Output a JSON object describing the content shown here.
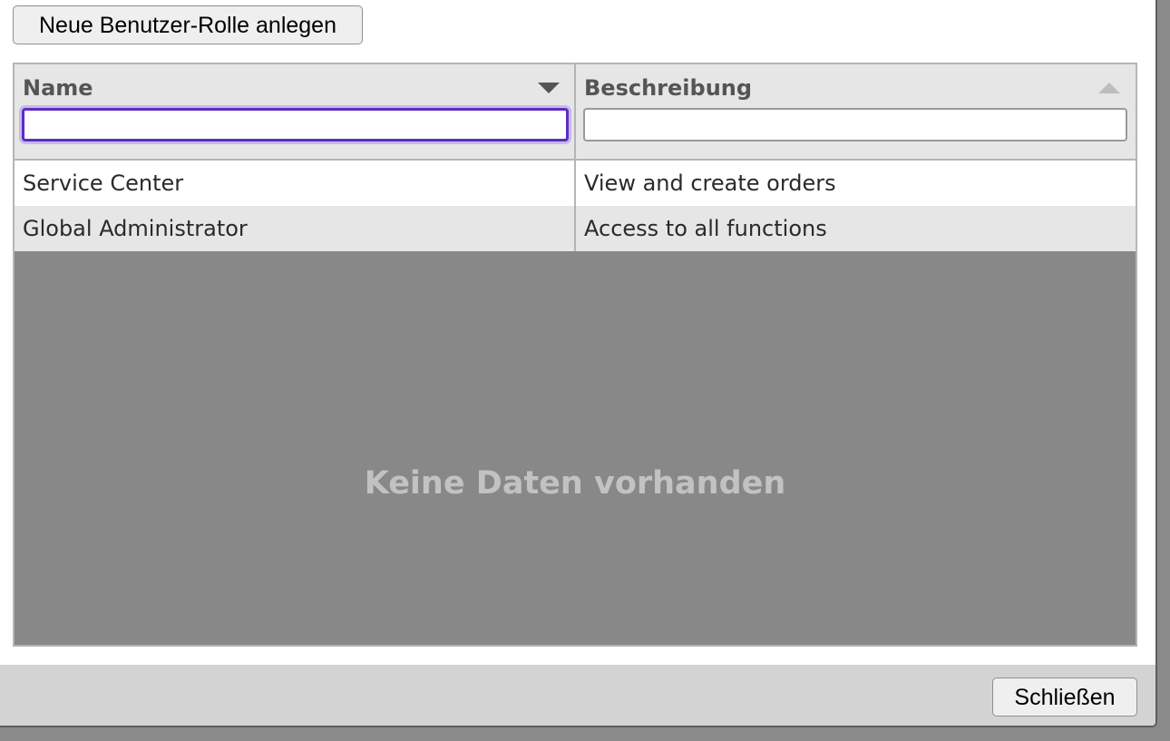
{
  "toolbar": {
    "new_role_label": "Neue Benutzer-Rolle anlegen"
  },
  "grid": {
    "columns": [
      {
        "title": "Name",
        "sort": "descending",
        "filter_value": ""
      },
      {
        "title": "Beschreibung",
        "sort": "ascending",
        "filter_value": ""
      }
    ],
    "rows": [
      {
        "name": "Service Center",
        "description": "View and create orders"
      },
      {
        "name": "Global Administrator",
        "description": "Access to all functions"
      }
    ],
    "empty_message": "Keine Daten vorhanden"
  },
  "footer": {
    "close_label": "Schließen"
  },
  "colors": {
    "focus_accent": "#5b2fc4",
    "header_bg": "#e6e6e6",
    "empty_area_bg": "#888888"
  }
}
